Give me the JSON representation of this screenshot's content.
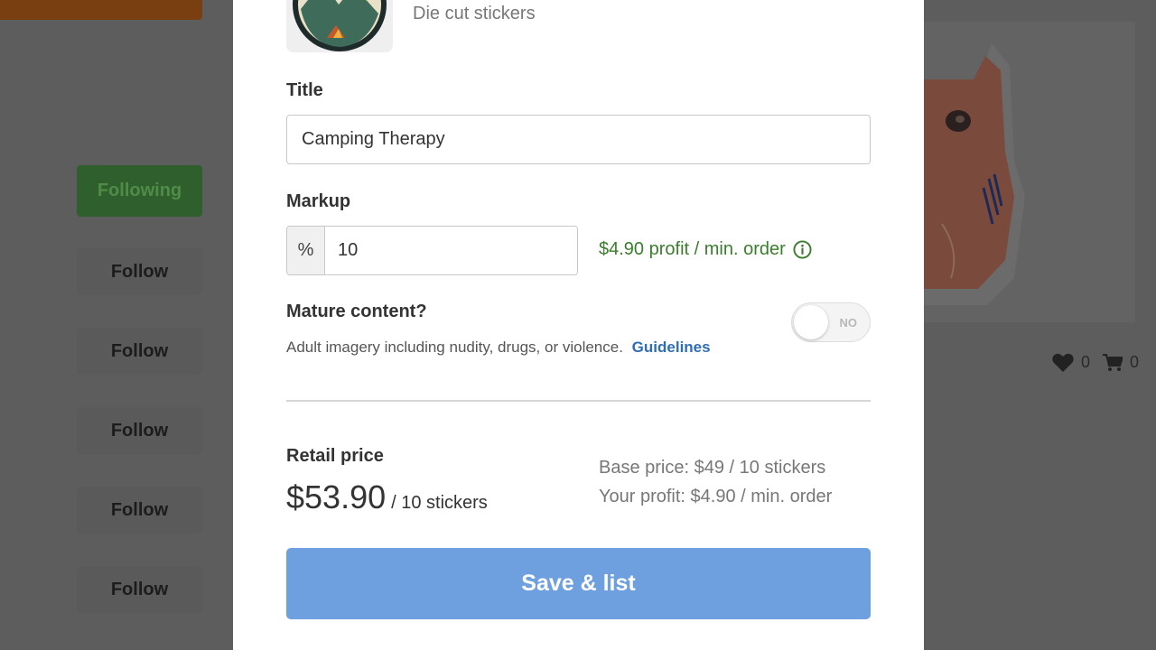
{
  "background": {
    "following_label": "Following",
    "follow_labels": [
      "Follow",
      "Follow",
      "Follow",
      "Follow",
      "Follow"
    ],
    "likes_count": "0",
    "cart_count": "0"
  },
  "product": {
    "type": "Die cut stickers"
  },
  "form": {
    "title_label": "Title",
    "title_value": "Camping Therapy",
    "markup_label": "Markup",
    "markup_prefix": "%",
    "markup_value": "10",
    "profit_note": "$4.90 profit / min. order",
    "mature_label": "Mature content?",
    "mature_desc": "Adult imagery including nudity, drugs, or violence.",
    "guidelines_link": "Guidelines",
    "mature_toggle_text": "NO"
  },
  "pricing": {
    "retail_label": "Retail price",
    "retail_price": "$53.90",
    "retail_unit": "/ 10 stickers",
    "base_price": "Base price: $49 / 10 stickers",
    "your_profit": "Your profit: $4.90 / min. order"
  },
  "actions": {
    "save_label": "Save & list"
  },
  "colors": {
    "accent_blue": "#6ea0e0",
    "profit_green": "#3a7d2c",
    "link_blue": "#2f6db5",
    "overlay": "#5d5d5d"
  },
  "icons": [
    "info-icon",
    "heart-icon",
    "cart-icon"
  ]
}
